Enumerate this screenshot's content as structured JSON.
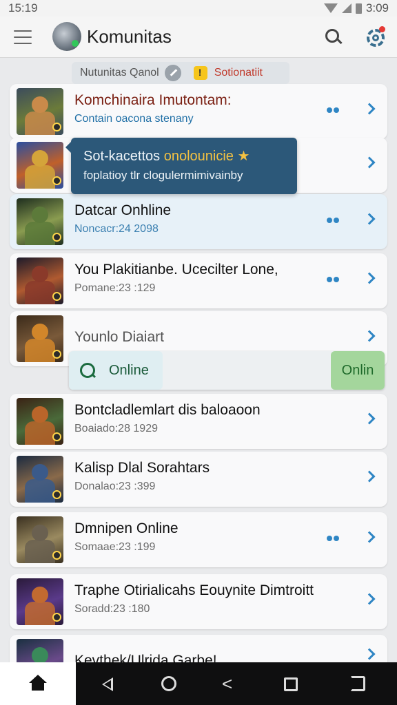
{
  "status_bar": {
    "time": "15:19",
    "clock_right": "3:09"
  },
  "app_bar": {
    "title": "Komunitas"
  },
  "chip": {
    "text": "Nutunitas Qanol",
    "status": "Sotionatiit"
  },
  "tooltip": {
    "line1_a": "Sot-kacettos ",
    "line1_accent": "onolounicie ★",
    "line2": "foplatioy tlr clogulermimivainby"
  },
  "items": [
    {
      "title": "Komchinaira Imutontam:",
      "subtitle": "Contain oacona stenany",
      "dots": true,
      "title_color": "#7a1f12",
      "sub_color": "#1f6fa6",
      "c1": "#3c4c5c",
      "c2": "#c98a4a",
      "c3": "#6b7b3a"
    },
    {
      "title": "",
      "subtitle": "",
      "dots": false,
      "c1": "#2a4ea0",
      "c2": "#d4a43a",
      "c3": "#c0602a"
    },
    {
      "title": "Datcar Onhline",
      "subtitle": "Noncacr:24 2098",
      "dots": true,
      "highlight": true,
      "sub_color": "#3a7fb0",
      "c1": "#1e2e1e",
      "c2": "#5c7a3a",
      "c3": "#8a9c50"
    },
    {
      "title": "You Plakitianbe. Ucecilter Lone,",
      "subtitle": "Pomane:23 :129",
      "dots": true,
      "c1": "#1c1a2a",
      "c2": "#8a3a2a",
      "c3": "#b05a30"
    },
    {
      "title": "Younlo Diaiart",
      "subtitle": "",
      "dots": false,
      "title_color": "#555",
      "c1": "#3a2a1a",
      "c2": "#d2862a",
      "c3": "#7a5a3a"
    },
    {
      "title": "Bontcladlemlart dis baloaoon",
      "subtitle": "Boaiado:28 1929",
      "dots": false,
      "c1": "#3a2214",
      "c2": "#b9652a",
      "c3": "#4a6a3a"
    },
    {
      "title": "Kalisp Dlal Sorahtars",
      "subtitle": "Donalao:23 :399",
      "dots": false,
      "c1": "#1a2a40",
      "c2": "#3a5a8a",
      "c3": "#8a6a4a"
    },
    {
      "title": "Dmnipen Online",
      "subtitle": "Somaae:23 :199",
      "dots": true,
      "c1": "#3a3020",
      "c2": "#6a6050",
      "c3": "#9a8a60"
    },
    {
      "title": "Traphe Otirialicahs Eouynite Dimtroitt",
      "subtitle": "Soradd:23 :180",
      "dots": false,
      "c1": "#2a1a3a",
      "c2": "#c26a30",
      "c3": "#5a3a8a"
    },
    {
      "title": "Kevthek/Ulrida Garbe!",
      "subtitle": "",
      "dots": false,
      "c1": "#1a3040",
      "c2": "#3a8a5a",
      "c3": "#6a4a8a"
    }
  ],
  "online_bar": {
    "left_label": "Online",
    "right_label": "Onlin"
  },
  "nav": [
    "home",
    "back",
    "home-circle",
    "share",
    "recents",
    "rotate"
  ]
}
